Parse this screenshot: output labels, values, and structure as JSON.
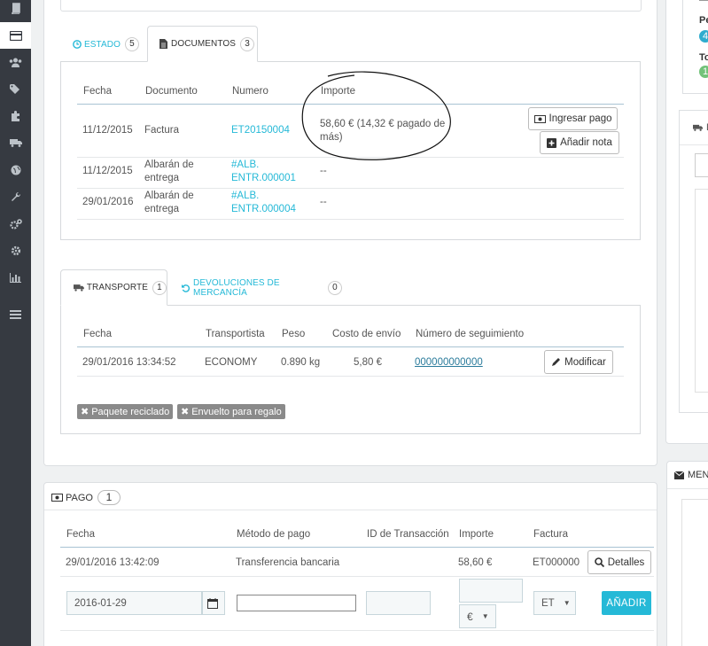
{
  "sidebar": {
    "items": [
      {
        "icon": "book-icon"
      },
      {
        "icon": "credit-card-icon"
      },
      {
        "icon": "users-icon"
      },
      {
        "icon": "tags-icon"
      },
      {
        "icon": "puzzle-icon"
      },
      {
        "icon": "truck-icon"
      },
      {
        "icon": "globe-icon"
      },
      {
        "icon": "wrench-icon"
      },
      {
        "icon": "cogs-icon"
      },
      {
        "icon": "gear-icon"
      },
      {
        "icon": "bar-chart-icon"
      },
      {
        "icon": "list-icon"
      }
    ]
  },
  "docs_panel": {
    "tabs": [
      {
        "label": "ESTADO",
        "count": "5"
      },
      {
        "label": "DOCUMENTOS",
        "count": "3"
      }
    ],
    "headers": [
      "Fecha",
      "Documento",
      "Numero",
      "Importe"
    ],
    "rows": [
      {
        "fecha": "11/12/2015",
        "documento": "Factura",
        "numero": "ET20150004",
        "importe": "58,60 € (14,32 € pagado de más)"
      },
      {
        "fecha": "11/12/2015",
        "documento": "Albarán de entrega",
        "numero": "#ALB. ENTR.000001",
        "importe": "--"
      },
      {
        "fecha": "29/01/2016",
        "documento": "Albarán de entrega",
        "numero": "#ALB. ENTR.000004",
        "importe": "--"
      }
    ],
    "buttons": {
      "ingresar_pago": "Ingresar pago",
      "anadir_nota": "Añadir nota"
    }
  },
  "shipping_panel": {
    "tabs": [
      {
        "label": "TRANSPORTE",
        "count": "1"
      },
      {
        "label": "DEVOLUCIONES DE MERCANCÍA",
        "count": "0"
      }
    ],
    "headers": [
      "Fecha",
      "Transportista",
      "Peso",
      "Costo de envío",
      "Número de seguimiento"
    ],
    "row": {
      "fecha": "29/01/2016 13:34:52",
      "transportista": "ECONOMY",
      "peso": "0.890 kg",
      "costo": "5,80 €",
      "tracking": "000000000000"
    },
    "modificar": "Modificar",
    "tags": [
      "Paquete reciclado",
      "Envuelto para regalo"
    ]
  },
  "payment_panel": {
    "title": "PAGO",
    "count": "1",
    "headers": [
      "Fecha",
      "Método de pago",
      "ID de Transacción",
      "Importe",
      "Factura"
    ],
    "row": {
      "fecha": "29/01/2016 13:42:09",
      "metodo": "Transferencia bancaria",
      "importe": "58,60 €",
      "factura": "ET000000"
    },
    "detalles": "Detalles",
    "form": {
      "date_value": "2016-01-29",
      "currency": "€",
      "invoice": "ET",
      "add_button": "AÑADIR"
    }
  },
  "right_col": {
    "status_letters_1": "Pe",
    "badge_1": "4",
    "status_letters_2": "To",
    "badge_2": "1",
    "mensajes_label": "MENS",
    "d_label": "D"
  }
}
